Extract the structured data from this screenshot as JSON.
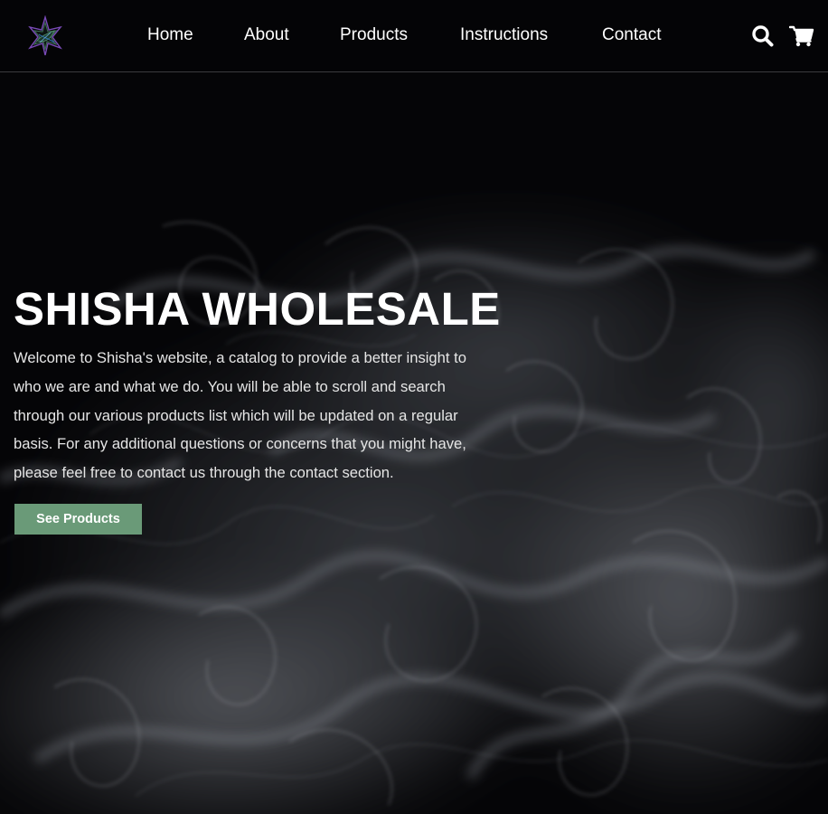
{
  "header": {
    "logo_icon": "leaf-star-logo-icon",
    "nav": [
      {
        "label": "Home"
      },
      {
        "label": "About"
      },
      {
        "label": "Products"
      },
      {
        "label": "Instructions"
      },
      {
        "label": "Contact"
      }
    ],
    "search_icon": "search-icon",
    "cart_icon": "cart-icon"
  },
  "hero": {
    "title": "SHISHA WHOLESALE",
    "description": "Welcome to Shisha's website, a catalog to provide a better insight to who we are and what we do. You will be able to scroll and search through our various products list which will be updated on a regular basis. For any additional questions or concerns that you might have, please feel free to contact us through the contact section.",
    "cta_label": "See Products",
    "background": "smoke-background"
  },
  "colors": {
    "background": "#050507",
    "text": "#ffffff",
    "accent": "#6a9a78"
  }
}
